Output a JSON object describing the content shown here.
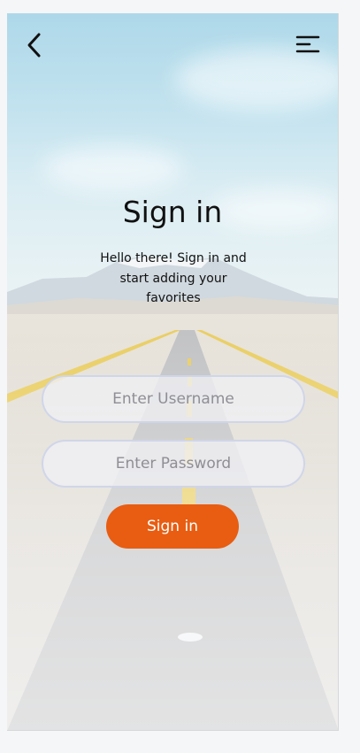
{
  "header": {
    "back_icon": "chevron-left-icon",
    "menu_icon": "menu-icon"
  },
  "main": {
    "title": "Sign in",
    "subtitle": "Hello there! Sign in and start adding your favorites",
    "username_placeholder": "Enter Username",
    "password_placeholder": "Enter Password",
    "signin_label": "Sign in"
  },
  "colors": {
    "accent": "#e85d12",
    "field_bg": "#f0f0f4",
    "field_border": "#cdd4e8",
    "text": "#111111"
  }
}
